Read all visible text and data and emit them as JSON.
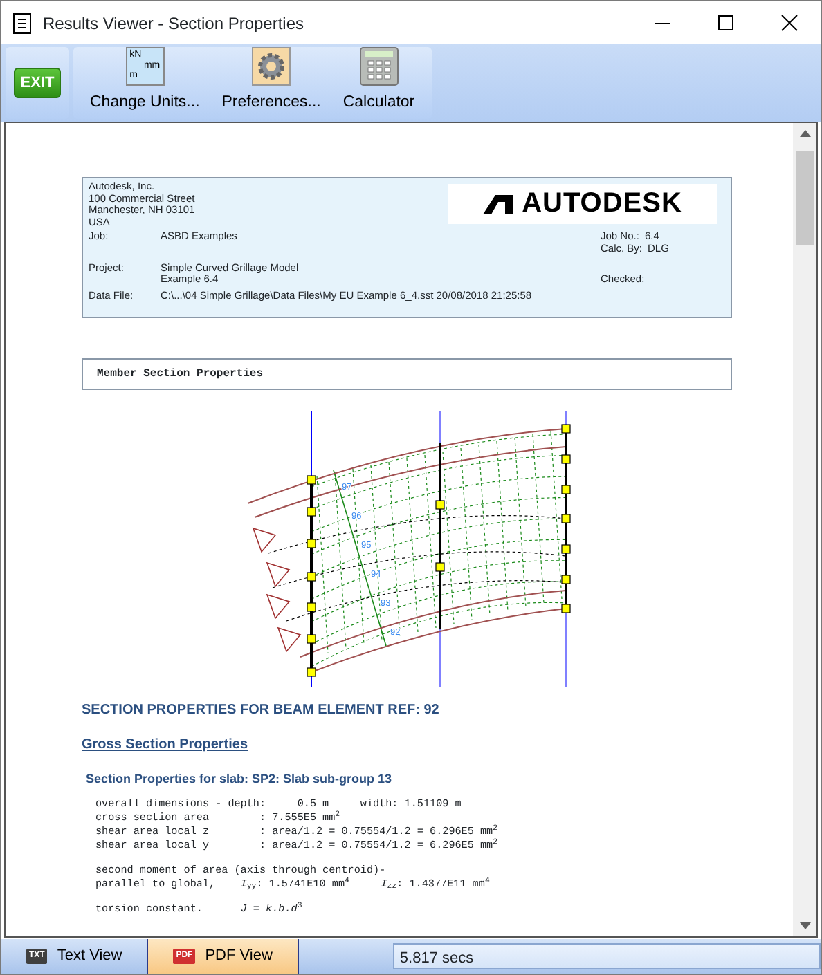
{
  "window": {
    "title": "Results Viewer - Section Properties"
  },
  "toolbar": {
    "exit_button": {
      "label": "EXIT"
    },
    "buttons": [
      {
        "kind": "units",
        "label": "Change Units...",
        "icon_text": [
          "kN",
          "mm",
          "m"
        ]
      },
      {
        "kind": "gear",
        "label": "Preferences..."
      },
      {
        "kind": "calculator",
        "label": "Calculator"
      }
    ]
  },
  "report": {
    "header": {
      "address": [
        "Autodesk, Inc.",
        "100 Commercial Street",
        "Manchester, NH 03101",
        "USA"
      ],
      "logo": "AUTODESK",
      "fields": [
        {
          "label": "Job:",
          "value": [
            "ASBD Examples"
          ]
        },
        {
          "label": "Project:",
          "value": [
            "Simple Curved Grillage Model",
            "Example 6.4"
          ]
        },
        {
          "label": "Data File:",
          "value": [
            "C:\\...\\04 Simple Grillage\\Data Files\\My EU Example 6_4.sst 20/08/2018 21:25:58"
          ]
        }
      ],
      "right_fields": [
        {
          "label": "Job No.:",
          "value": "6.4"
        },
        {
          "label": "Calc. By:",
          "value": "DLG"
        },
        {
          "label": "Checked:"
        }
      ]
    },
    "section_title": "Member Section Properties",
    "drawing": {
      "labels": [
        "97",
        "96",
        "95",
        "94",
        "93",
        "92"
      ]
    },
    "heading": "SECTION PROPERTIES FOR BEAM ELEMENT REF: 92",
    "subheading": "Gross Section Properties",
    "slab_title": "Section Properties for slab: SP2: Slab sub-group 13",
    "blocks": [
      [
        "overall dimensions - depth:     0.5 m     width: 1.51109 m",
        "cross section area        : 7.555E5 mm$^{2}$",
        "shear area local z        : area/1.2 = 0.75554/1.2 = 6.296E5 mm$^{2}$",
        "shear area local y        : area/1.2 = 0.75554/1.2 = 6.296E5 mm$^{2}$"
      ],
      [
        "second moment of area (axis through centroid)-",
        "parallel to global,    *I*$_{yy}$: 1.5741E10 mm$^{4}$     *I*$_{zz}$: 1.4377E11 mm$^{4}$"
      ],
      [
        "torsion constant.      *J = k.b.d*$^{3}$"
      ]
    ]
  },
  "bottom_tabs": [
    {
      "label": "Text View",
      "icon_text": "TXT",
      "selected": false
    },
    {
      "label": "PDF View",
      "icon_text": "PDF",
      "selected": true
    }
  ],
  "status": "5.817 secs"
}
